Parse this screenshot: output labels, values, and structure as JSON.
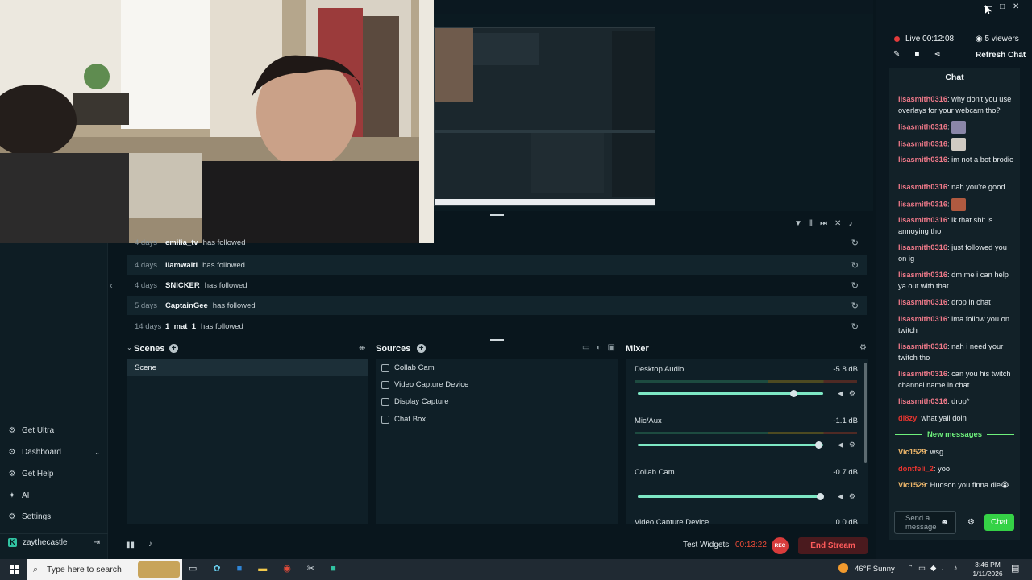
{
  "sidebar": {
    "items": [
      {
        "label": "Get Ultra",
        "icon": "ultra-icon"
      },
      {
        "label": "Dashboard",
        "icon": "dashboard-icon"
      },
      {
        "label": "Get Help",
        "icon": "help-icon"
      },
      {
        "label": "AI",
        "icon": "ai-sparkle-icon"
      },
      {
        "label": "Settings",
        "icon": "gear-icon"
      }
    ],
    "user": "zaythecastle"
  },
  "activity_feed": {
    "rows": [
      {
        "days": "4 days",
        "name": "emilia_tv",
        "action": "has followed"
      },
      {
        "days": "4 days",
        "name": "liamwalti",
        "action": "has followed"
      },
      {
        "days": "4 days",
        "name": "SNICKER",
        "action": "has followed"
      },
      {
        "days": "5 days",
        "name": "CaptainGee",
        "action": "has followed"
      },
      {
        "days": "14 days",
        "name": "1_mat_1",
        "action": "has followed"
      }
    ]
  },
  "scenes": {
    "title": "Scenes",
    "items": [
      "Scene"
    ]
  },
  "sources": {
    "title": "Sources",
    "items": [
      "Collab Cam",
      "Video Capture Device",
      "Display Capture",
      "Chat Box"
    ]
  },
  "mixer": {
    "title": "Mixer",
    "channels": [
      {
        "name": "Desktop Audio",
        "db": "-5.8 dB",
        "level": 0.84
      },
      {
        "name": "Mic/Aux",
        "db": "-1.1 dB",
        "level": 0.97
      },
      {
        "name": "Collab Cam",
        "db": "-0.7 dB",
        "level": 0.98
      },
      {
        "name": "Video Capture Device",
        "db": "0.0 dB",
        "level": 1.0
      }
    ]
  },
  "footer": {
    "test_widgets": "Test Widgets",
    "timer": "00:13:22",
    "rec": "REC",
    "end_stream": "End Stream"
  },
  "chat": {
    "live_label": "Live",
    "live_time": "00:12:08",
    "viewers": "5 viewers",
    "refresh": "Refresh Chat",
    "title": "Chat",
    "messages": [
      {
        "user": "lisasmith0316",
        "text": "why don't you use overlays for your webcam tho?"
      },
      {
        "user": "lisasmith0316",
        "text": ""
      },
      {
        "user": "lisasmith0316",
        "text": ""
      },
      {
        "user": "lisasmith0316",
        "text": "im not a bot brodie"
      },
      {
        "user": "lisasmith0316",
        "text": "nah you're good"
      },
      {
        "user": "lisasmith0316",
        "text": ""
      },
      {
        "user": "lisasmith0316",
        "text": "ik that shit is annoying tho"
      },
      {
        "user": "lisasmith0316",
        "text": "just followed you on ig"
      },
      {
        "user": "lisasmith0316",
        "text": "dm me i can help ya out with that"
      },
      {
        "user": "lisasmith0316",
        "text": "drop in chat"
      },
      {
        "user": "lisasmith0316",
        "text": "ima follow you on twitch"
      },
      {
        "user": "lisasmith0316",
        "text": "nah i need your twitch tho"
      },
      {
        "user": "lisasmith0316",
        "text": "can you his twitch channel name in chat"
      },
      {
        "user": "lisasmith0316",
        "text": "drop*"
      },
      {
        "user": "di8zy",
        "text": "what yall doin"
      }
    ],
    "new_messages": "New messages",
    "new": [
      {
        "user": "Vic1529",
        "text": "wsg"
      },
      {
        "user": "dontfeli_2",
        "text": "yoo"
      },
      {
        "user": "Vic1529",
        "text": "Hudson you finna die😭"
      }
    ],
    "input_placeholder": "Send a message",
    "send_label": "Chat"
  },
  "taskbar": {
    "search_placeholder": "Type here to search",
    "weather": "46°F  Sunny",
    "time": "3:46 PM",
    "date": "1/11/2026"
  },
  "colors": {
    "accent": "#31c3a2",
    "live": "#e33b3b",
    "chat_user": "#f17a8a",
    "new_msgs": "#6ef07c"
  }
}
